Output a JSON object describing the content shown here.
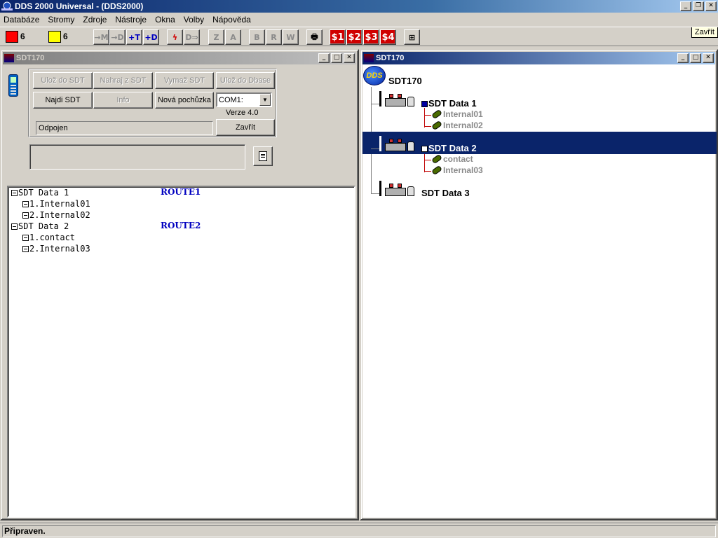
{
  "app": {
    "title": "DDS 2000 Universal - (DDS2000)",
    "window_controls": [
      "_",
      "❐",
      "✕"
    ],
    "tooltip": "Zavřít"
  },
  "menu": [
    "Databáze",
    "Stromy",
    "Zdroje",
    "Nástroje",
    "Okna",
    "Volby",
    "Nápověda"
  ],
  "toolbar": {
    "red_count": "6",
    "yellow_count": "6",
    "red_color": "#ff0000",
    "yellow_color": "#ffff00",
    "buttons": [
      {
        "label": "→M",
        "icon": "arrow-m-icon"
      },
      {
        "label": "→D",
        "icon": "arrow-d-icon"
      },
      {
        "label": "+T",
        "icon": "plus-t-icon"
      },
      {
        "label": "+D",
        "icon": "plus-d-icon"
      },
      {
        "label": "ϟ",
        "icon": "lightning-icon"
      },
      {
        "label": "D⇒",
        "icon": "transfer-icon"
      },
      {
        "label": "Z",
        "icon": "z-icon"
      },
      {
        "label": "A",
        "icon": "a-icon"
      },
      {
        "label": "B",
        "icon": "b-icon"
      },
      {
        "label": "R",
        "icon": "r-icon"
      },
      {
        "label": "W",
        "icon": "w-icon"
      },
      {
        "label": "🖶",
        "icon": "printer-icon"
      },
      {
        "label": "$1",
        "icon": "s1-icon"
      },
      {
        "label": "$2",
        "icon": "s2-icon"
      },
      {
        "label": "$3",
        "icon": "s3-icon"
      },
      {
        "label": "$4",
        "icon": "s4-icon"
      },
      {
        "label": "⊞",
        "icon": "grid-tool-icon"
      }
    ]
  },
  "left_window": {
    "title": "SDT170",
    "controls": [
      "_",
      "□",
      "✕"
    ],
    "buttons": {
      "uloz_sdt": "Ulož do SDT",
      "nahraj": "Nahraj z SDT",
      "vymaz": "Vymaž SDT",
      "uloz_dbase": "Ulož do Dbase",
      "najdi": "Najdi SDT",
      "info": "Info",
      "nova": "Nová pochůzka",
      "zavrit": "Zavřít"
    },
    "port": "COM1:",
    "version": "Verze 4.0",
    "status": "Odpojen",
    "routes": [
      {
        "name": "SDT Data 1",
        "route": "ROUTE1",
        "points": [
          "1.Internal01",
          "2.Internal02"
        ]
      },
      {
        "name": "SDT Data 2",
        "route": "ROUTE2",
        "points": [
          "1.contact",
          "2.Internal03"
        ]
      }
    ]
  },
  "right_window": {
    "title": "SDT170",
    "controls": [
      "_",
      "□",
      "✕"
    ],
    "logo": "DDS",
    "root": "SDT170",
    "nodes": [
      {
        "name": "SDT Data 1",
        "leaves": [
          "Internal01",
          "Internal02"
        ]
      },
      {
        "name": "SDT Data 2",
        "leaves": [
          "contact",
          "Internal03"
        ]
      },
      {
        "name": "SDT Data 3",
        "leaves": []
      }
    ]
  },
  "status": "Připraven."
}
